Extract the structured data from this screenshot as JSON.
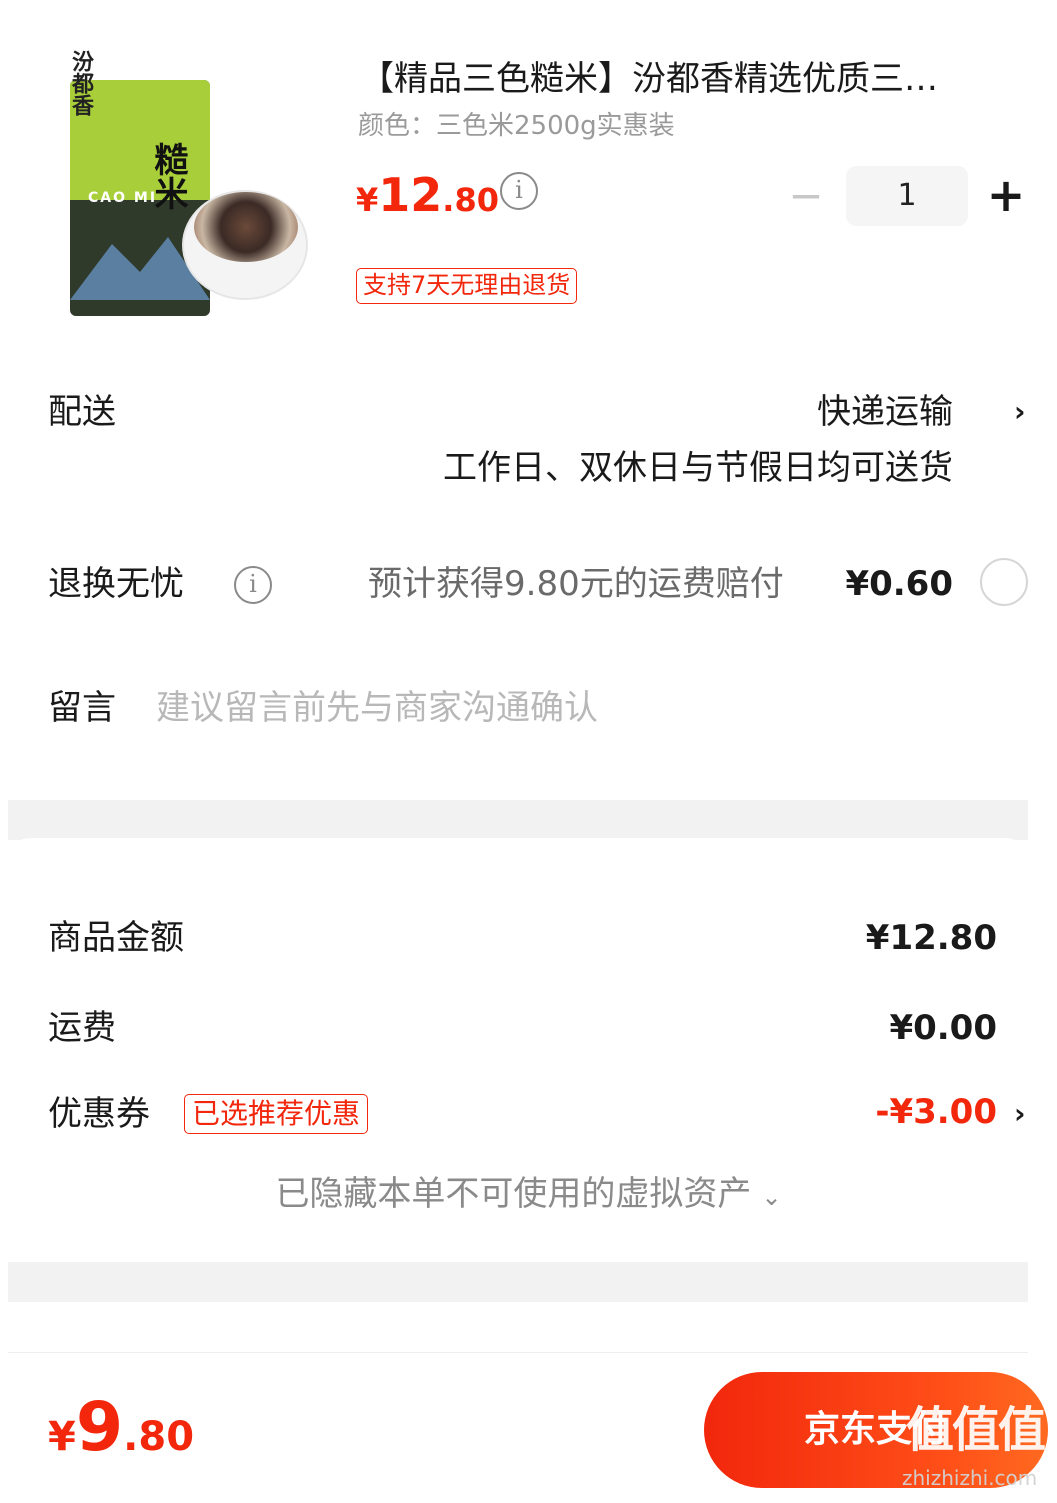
{
  "product": {
    "image_caption": "糙米",
    "image_caption_latin": "CAO MI",
    "image_logo": "汾都香",
    "title": "【精品三色糙米】汾都香精选优质三…",
    "spec": "颜色：三色米2500g实惠装",
    "price_yen": "¥",
    "price_int": "12",
    "price_dec": ".80",
    "quantity_minus": "−",
    "quantity": "1",
    "quantity_plus": "+",
    "return_tag": "支持7天无理由退货"
  },
  "delivery": {
    "label": "配送",
    "method": "快递运输",
    "note": "工作日、双休日与节假日均可送货",
    "chevron": "›"
  },
  "return_insurance": {
    "label": "退换无忧",
    "info_icon": "i",
    "description": "预计获得9.80元的运费赔付",
    "price": "¥0.60",
    "selected": false
  },
  "message": {
    "label": "留言",
    "placeholder": "建议留言前先与商家沟通确认"
  },
  "summary": {
    "goods_label": "商品金额",
    "goods_value": "¥12.80",
    "shipping_label": "运费",
    "shipping_value": "¥0.00",
    "coupon_label": "优惠券",
    "coupon_tag": "已选推荐优惠",
    "coupon_value": "-¥3.00",
    "coupon_chevron": "›",
    "hidden_assets_note": "已隐藏本单不可使用的虚拟资产",
    "hidden_assets_caret": "⌄"
  },
  "footer": {
    "total_yen": "¥",
    "total_int": "9",
    "total_dec": ".80",
    "pay_button": "京东支付"
  },
  "watermark": {
    "logo": "值值值",
    "text": "zhizhizhi.com"
  },
  "colors": {
    "accent": "#f2270c",
    "muted_text": "#9a9a9a",
    "separator": "#f2f2f2"
  },
  "icons": {
    "info": "info-icon",
    "chevron": "chevron-right-icon",
    "radio": "radio-unchecked-icon",
    "caret": "chevron-down-icon"
  }
}
